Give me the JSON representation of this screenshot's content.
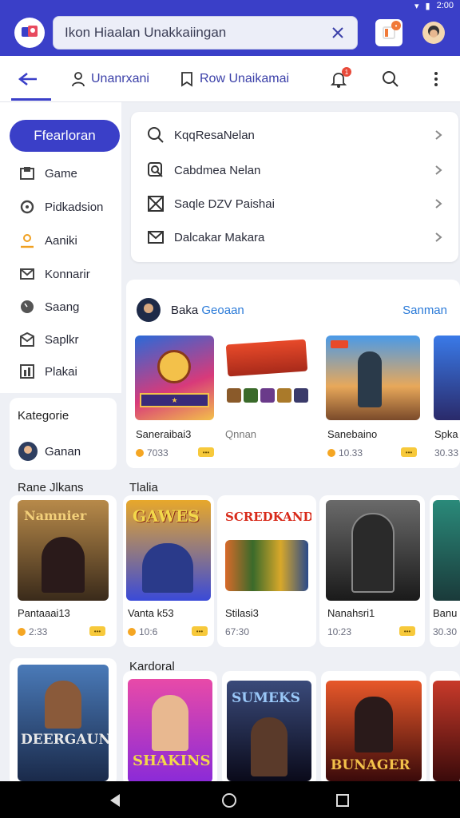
{
  "app": {
    "search_text": "Ikon Hiaalan Unakkaiingan",
    "status_time": "2:00"
  },
  "nav": {
    "tab1": "Unanrxani",
    "tab2": "Row Unaikamai",
    "notif_count": "1"
  },
  "sidebar": {
    "button": "Ffearloran",
    "items": [
      "Game",
      "Pidkadsion",
      "Aaniki",
      "Konnarir",
      "Saang",
      "Saplkr",
      "Plakai"
    ]
  },
  "menu": {
    "items": [
      "KqqResaNelan",
      "Cabdmea Nelan",
      "Saqle DZV Paishai",
      "Dalcakar Makara"
    ]
  },
  "featured": {
    "author": "Baka",
    "author_highlight": "Geoaan",
    "see_all": "Sanman",
    "games": [
      {
        "name": "Saneraibai3",
        "meta": "7033",
        "art": "kingdom"
      },
      {
        "name": "Qnnan",
        "meta": "",
        "art": "nanrun"
      },
      {
        "name": "Sanebaino",
        "meta": "10.33",
        "art": "soldier"
      },
      {
        "name": "Spka",
        "meta": "30.33",
        "art": "blue"
      }
    ]
  },
  "kategorie": {
    "title": "Kategorie",
    "user": "Ganan"
  },
  "row2": {
    "left_title": "Rane Jlkans",
    "section_title": "Tlalia",
    "games": [
      {
        "name": "Pantaaai13",
        "meta": "2:33",
        "art": "cowboy",
        "title": "Namnier"
      },
      {
        "name": "Vanta k53",
        "meta": "10:6",
        "art": "games",
        "title": "GAWES"
      },
      {
        "name": "Stilasi3",
        "meta": "67:30",
        "art": "squad",
        "title": "SCREDKAND"
      },
      {
        "name": "Nanahsri1",
        "meta": "10:23",
        "art": "grey",
        "title": ""
      },
      {
        "name": "Banu",
        "meta": "30.30",
        "art": "teal",
        "title": ""
      }
    ]
  },
  "row3": {
    "section_title": "Kardoral",
    "games": [
      {
        "art": "deer",
        "title": "DEERGAUN"
      },
      {
        "art": "pink",
        "title": "SHAKINS"
      },
      {
        "art": "dark",
        "title": "SUMEKS"
      },
      {
        "art": "fire",
        "title": "BUNAGER"
      },
      {
        "art": "red",
        "title": ""
      }
    ]
  },
  "colors": {
    "primary": "#3a3fc8",
    "accent": "#f7c93b",
    "background": "#eef0f5"
  }
}
